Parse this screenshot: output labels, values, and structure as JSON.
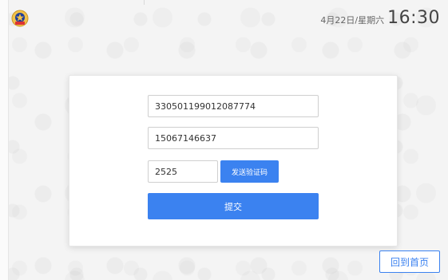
{
  "header": {
    "date": "4月22日/星期六",
    "time": "16:30",
    "emblem_icon": "police-emblem-icon"
  },
  "form": {
    "id_number": "330501199012087774",
    "phone": "15067146637",
    "verification_code": "2525",
    "send_code_label": "发送验证码",
    "submit_label": "提交"
  },
  "footer": {
    "home_label": "回到首页"
  },
  "colors": {
    "primary": "#3b82f0",
    "background": "#f4f4f4"
  }
}
